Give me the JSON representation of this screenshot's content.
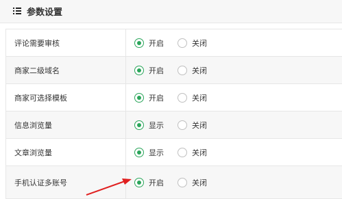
{
  "header": {
    "title": "参数设置",
    "icon": "list-icon"
  },
  "rows": [
    {
      "label": "评论需要审核",
      "options": [
        "开启",
        "关闭"
      ],
      "selected": 0
    },
    {
      "label": "商家二级域名",
      "options": [
        "开启",
        "关闭"
      ],
      "selected": 0
    },
    {
      "label": "商家可选择模板",
      "options": [
        "开启",
        "关闭"
      ],
      "selected": 0
    },
    {
      "label": "信息浏览量",
      "options": [
        "显示",
        "关闭"
      ],
      "selected": 0
    },
    {
      "label": "文章浏览量",
      "options": [
        "显示",
        "关闭"
      ],
      "selected": 0
    },
    {
      "label": "手机认证多账号",
      "options": [
        "开启",
        "关闭"
      ],
      "selected": 0
    }
  ],
  "colors": {
    "accent": "#2aa55a",
    "arrow": "#e02020"
  }
}
